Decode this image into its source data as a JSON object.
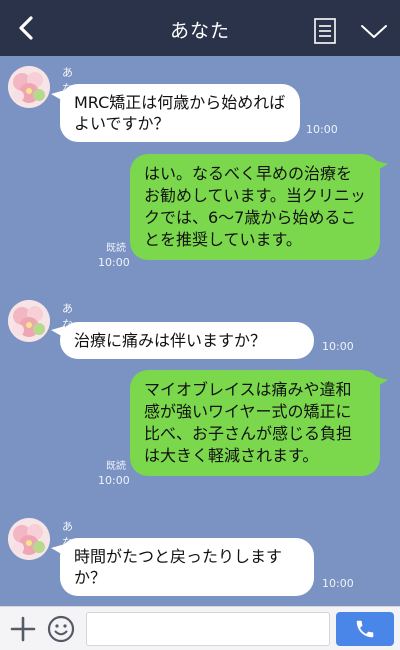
{
  "header": {
    "title": "あなた"
  },
  "messages": [
    {
      "sender": "あなた",
      "text": "MRC矯正は何歳から始めればよいですか？",
      "time": "10:00"
    },
    {
      "text": "はい。なるべく早めの治療をお勧めしています。当クリニックでは、6〜7歳から始めることを推奨しています。",
      "read": "既読",
      "time": "10:00"
    },
    {
      "sender": "あなた",
      "text": "治療に痛みは伴いますか？",
      "time": "10:00"
    },
    {
      "text": "マイオブレイスは痛みや違和感が強いワイヤー式の矯正に比べ、お子さんが感じる負担は大きく軽減されます。",
      "read": "既読",
      "time": "10:00"
    },
    {
      "sender": "あなた",
      "text": "時間がたつと戻ったりしますか？",
      "time": "10:00"
    }
  ],
  "input": {
    "placeholder": ""
  },
  "icons": {
    "back": "chevron-left-icon",
    "menu": "notes-icon",
    "chevron": "chevron-down-icon",
    "plus": "plus-icon",
    "emoji": "smiley-icon",
    "send": "phone-icon"
  },
  "colors": {
    "header": "#2a3349",
    "background": "#7b93c3",
    "incoming": "#ffffff",
    "outgoing": "#7bd84c",
    "send": "#4a86e8"
  }
}
